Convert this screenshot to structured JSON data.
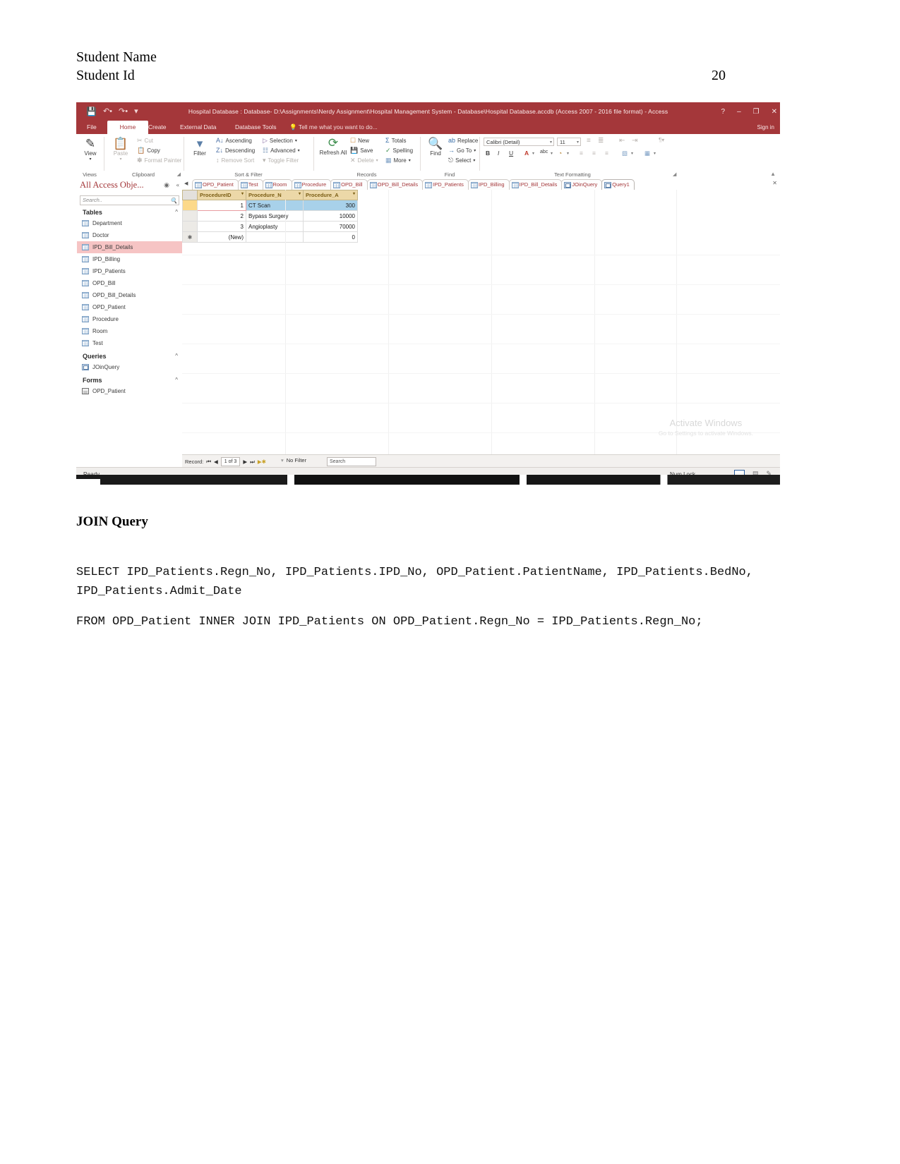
{
  "document": {
    "header_lines": [
      "Student Name",
      "Student Id"
    ],
    "page_number": "20",
    "section_heading": "JOIN Query",
    "sql_block_1": "SELECT IPD_Patients.Regn_No, IPD_Patients.IPD_No, OPD_Patient.PatientName, IPD_Patients.BedNo, IPD_Patients.Admit_Date",
    "sql_block_2": "FROM OPD_Patient INNER JOIN IPD_Patients ON OPD_Patient.Regn_No = IPD_Patients.Regn_No;"
  },
  "access": {
    "titlebar": {
      "title": "Hospital Database : Database- D:\\Assignments\\Nerdy Assignment\\Hospital Management System - Database\\Hospital Database.accdb (Access 2007 - 2016 file format) - Access",
      "quick_access": [
        "save-icon",
        "undo-icon",
        "redo-icon",
        "customize-qat-icon"
      ],
      "help": "?",
      "minimize": "–",
      "restore": "❐",
      "close": "✕"
    },
    "ribbon_tabs": {
      "file": "File",
      "items": [
        "Home",
        "Create",
        "External Data",
        "Database Tools"
      ],
      "active": "Home",
      "tell_me": "Tell me what you want to do...",
      "sign_in": "Sign in"
    },
    "ribbon": {
      "groups": [
        {
          "label": "Views"
        },
        {
          "label": "Clipboard"
        },
        {
          "label": "Sort & Filter"
        },
        {
          "label": "Records"
        },
        {
          "label": "Find"
        },
        {
          "label": "Text Formatting"
        }
      ],
      "view_button": "View",
      "paste_button": "Paste",
      "clipboard_items": [
        "Cut",
        "Copy",
        "Format Painter"
      ],
      "filter_button": "Filter",
      "sort_items": [
        "Ascending",
        "Descending",
        "Remove Sort"
      ],
      "filter_items": [
        "Selection",
        "Advanced",
        "Toggle Filter"
      ],
      "refresh_button": "Refresh All",
      "records_items": [
        "New",
        "Save",
        "Delete",
        "Totals",
        "Spelling",
        "More"
      ],
      "find_button": "Find",
      "find_items": [
        "Replace",
        "Go To",
        "Select"
      ],
      "font_name": "Calibri (Detail)",
      "font_size": "11",
      "format_buttons": [
        "B",
        "I",
        "U",
        "A",
        "abc",
        "fill",
        "align-left",
        "align-center",
        "align-right",
        "grid",
        "table"
      ]
    },
    "nav_pane": {
      "title": "All Access Obje...",
      "search_placeholder": "Search..",
      "groups": [
        {
          "label": "Tables",
          "items": [
            {
              "label": "Department",
              "icon": "table-icon",
              "selected": false
            },
            {
              "label": "Doctor",
              "icon": "table-icon",
              "selected": false
            },
            {
              "label": "IPD_Bill_Details",
              "icon": "table-icon",
              "selected": true
            },
            {
              "label": "IPD_Billing",
              "icon": "table-icon",
              "selected": false
            },
            {
              "label": "IPD_Patients",
              "icon": "table-icon",
              "selected": false
            },
            {
              "label": "OPD_Bill",
              "icon": "table-icon",
              "selected": false
            },
            {
              "label": "OPD_Bill_Details",
              "icon": "table-icon",
              "selected": false
            },
            {
              "label": "OPD_Patient",
              "icon": "table-icon",
              "selected": false
            },
            {
              "label": "Procedure",
              "icon": "table-icon",
              "selected": false
            },
            {
              "label": "Room",
              "icon": "table-icon",
              "selected": false
            },
            {
              "label": "Test",
              "icon": "table-icon",
              "selected": false
            }
          ]
        },
        {
          "label": "Queries",
          "items": [
            {
              "label": "JOinQuery",
              "icon": "query-icon",
              "selected": false
            }
          ]
        },
        {
          "label": "Forms",
          "items": [
            {
              "label": "OPD_Patient",
              "icon": "form-icon",
              "selected": false
            }
          ]
        }
      ]
    },
    "doc_tabs": [
      {
        "label": "OPD_Patient",
        "icon": "table-icon",
        "active": false
      },
      {
        "label": "Test",
        "icon": "table-icon",
        "active": false
      },
      {
        "label": "Room",
        "icon": "table-icon",
        "active": false
      },
      {
        "label": "Procedure",
        "icon": "table-icon",
        "active": false
      },
      {
        "label": "OPD_Bill",
        "icon": "table-icon",
        "active": false
      },
      {
        "label": "OPD_Bill_Details",
        "icon": "table-icon",
        "active": false
      },
      {
        "label": "IPD_Patients",
        "icon": "table-icon",
        "active": false
      },
      {
        "label": "IPD_Billing",
        "icon": "table-icon",
        "active": false
      },
      {
        "label": "IPD_Bill_Details",
        "icon": "table-icon",
        "active": false
      },
      {
        "label": "JOinQuery",
        "icon": "query-icon",
        "active": false
      },
      {
        "label": "Query1",
        "icon": "query-icon",
        "active": true
      }
    ],
    "datasheet": {
      "columns": [
        "ProcedureID",
        "Procedure_N",
        "Procedure_A"
      ],
      "rows": [
        {
          "id": "1",
          "name": "CT Scan",
          "amount": "300",
          "current": true
        },
        {
          "id": "2",
          "name": "Bypass Surgery",
          "amount": "10000",
          "current": false
        },
        {
          "id": "3",
          "name": "Angioplasty",
          "amount": "70000",
          "current": false
        }
      ],
      "new_row": {
        "id": "(New)",
        "name": "",
        "amount": "0"
      }
    },
    "record_nav": {
      "label": "Record:",
      "position": "1 of 3",
      "filter_status": "No Filter",
      "search_placeholder": "Search"
    },
    "status_bar": {
      "status": "Ready",
      "num_lock": "Num Lock"
    },
    "watermark": {
      "line1": "Activate Windows",
      "line2": "Go to Settings to activate Windows."
    }
  }
}
